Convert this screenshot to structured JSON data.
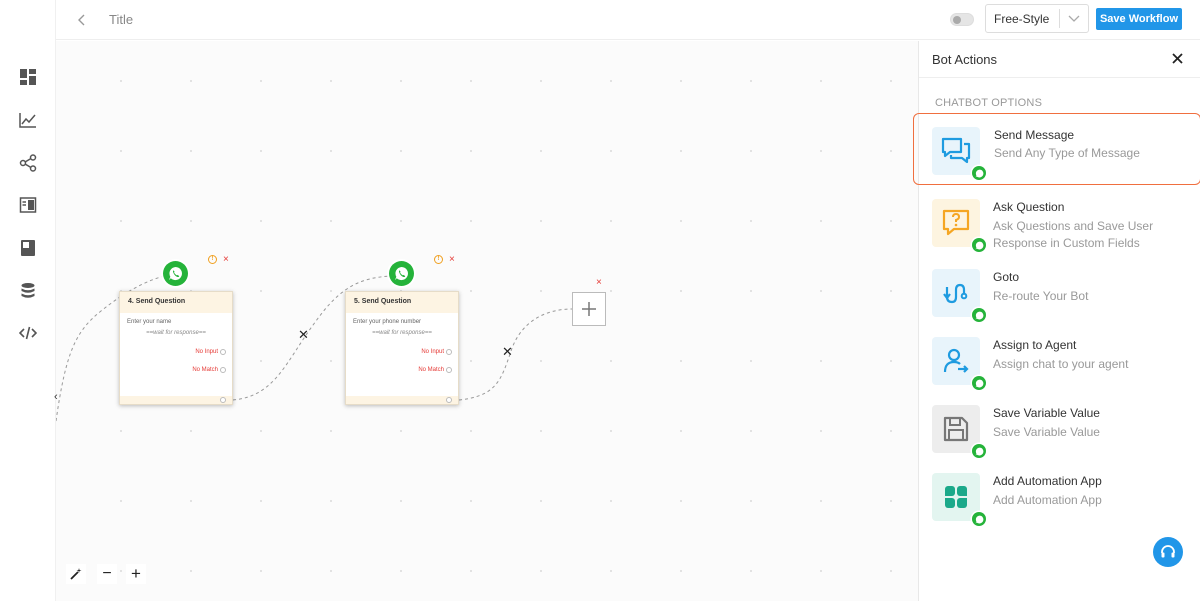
{
  "header": {
    "title": "Title",
    "mode": "Free-Style",
    "save_label": "Save Workflow"
  },
  "sidebar": {
    "items": [
      {
        "icon": "dashboard-icon"
      },
      {
        "icon": "analytics-chart-icon"
      },
      {
        "icon": "workflow-share-icon"
      },
      {
        "icon": "layout-panel-icon"
      },
      {
        "icon": "book-icon"
      },
      {
        "icon": "database-icon"
      },
      {
        "icon": "code-icon"
      }
    ]
  },
  "canvas": {
    "nodes": [
      {
        "title": "4. Send Question",
        "prompt": "Enter your name",
        "wait": "==wait for response==",
        "outputs": [
          "No Input",
          "No Match"
        ]
      },
      {
        "title": "5. Send Question",
        "prompt": "Enter your phone number",
        "wait": "==wait for response==",
        "outputs": [
          "No Input",
          "No Match"
        ]
      }
    ],
    "warn_glyph": "!",
    "close_glyph": "×",
    "cut_glyph": "✕",
    "zoom": {
      "minus": "−",
      "plus": "+"
    }
  },
  "panel": {
    "title": "Bot Actions",
    "section": "CHATBOT OPTIONS",
    "actions": [
      {
        "name": "Send Message",
        "desc": "Send Any Type of Message",
        "icon": "chat-bubbles-icon",
        "color": "#1e9be0",
        "bg": "#e8f4fb"
      },
      {
        "name": "Ask Question",
        "desc": "Ask Questions and Save User Response in Custom Fields",
        "icon": "question-bubble-icon",
        "color": "#f5a623",
        "bg": "#fdf4e0"
      },
      {
        "name": "Goto",
        "desc": "Re-route Your Bot",
        "icon": "reroute-icon",
        "color": "#1e9be0",
        "bg": "#e8f4fb"
      },
      {
        "name": "Assign to Agent",
        "desc": "Assign chat to your agent",
        "icon": "agent-assign-icon",
        "color": "#1e9be0",
        "bg": "#e8f4fb"
      },
      {
        "name": "Save Variable Value",
        "desc": "Save Variable Value",
        "icon": "floppy-save-icon",
        "color": "#777777",
        "bg": "#ededed"
      },
      {
        "name": "Add Automation App",
        "desc": "Add Automation App",
        "icon": "automation-app-icon",
        "color": "#1ba98a",
        "bg": "#e3f5f0"
      }
    ]
  },
  "colors": {
    "accent": "#2196e8",
    "whatsapp": "#25b33a",
    "selection": "#f06f3f",
    "error": "#e53935"
  }
}
